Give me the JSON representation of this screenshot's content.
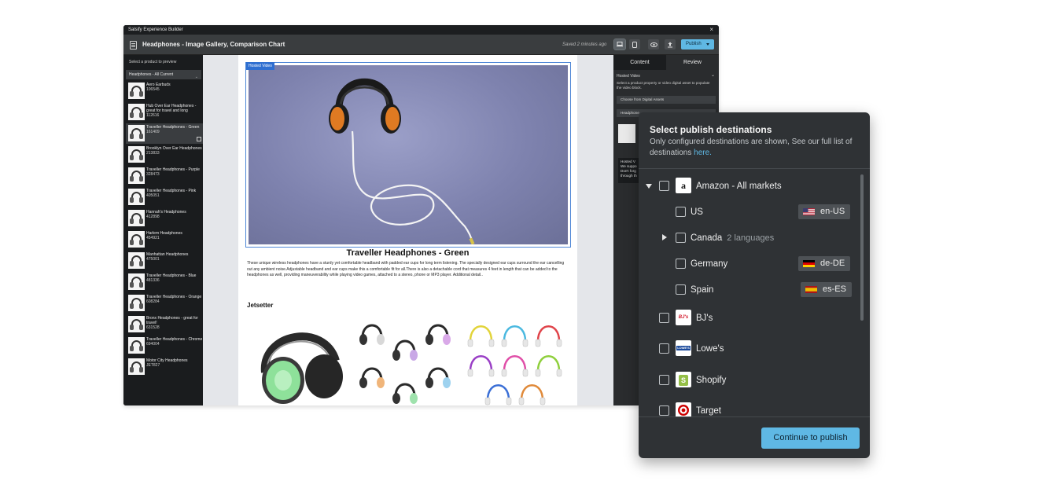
{
  "window": {
    "title": "Salsify Experience Builder",
    "close_label": "×"
  },
  "toolbar": {
    "title": "Headphones - Image Gallery, Comparison Chart",
    "saved": "Saved 2 minutes ago",
    "publish_label": "Publish"
  },
  "sidebar": {
    "hint": "Select a product to preview",
    "select_value": "Headphones - All Current",
    "products": [
      {
        "name": "Aero Earbuds",
        "sku": "106545"
      },
      {
        "name": "Hub Over Ear Headphones - great for travel and long",
        "sku": "112616"
      },
      {
        "name": "Traveller Headphones - Green",
        "sku": "161409",
        "selected": true
      },
      {
        "name": "Brooklyn Over Ear Headphones",
        "sku": "213833"
      },
      {
        "name": "Traveller Headphones - Purple",
        "sku": "328473"
      },
      {
        "name": "Traveller Headphones - Pink",
        "sku": "405051"
      },
      {
        "name": "Hannah's Headphones",
        "sku": "412898"
      },
      {
        "name": "Harlem Headphones",
        "sku": "454921"
      },
      {
        "name": "Manhattan Headphones",
        "sku": "475001"
      },
      {
        "name": "Traveller Headphones - Blue",
        "sku": "481336"
      },
      {
        "name": "Traveller Headphones - Orange",
        "sku": "608284"
      },
      {
        "name": "Bronx Headphones - great for travel!",
        "sku": "631528"
      },
      {
        "name": "Traveller Headphones - Chrome",
        "sku": "694004"
      },
      {
        "name": "Motor City Headphones",
        "sku": "JET827"
      }
    ]
  },
  "canvas": {
    "video_label": "Hosted Video",
    "product_title": "Traveller Headphones - Green",
    "description": "These unique wireless headphones have a sturdy yet comfortable headband with padded ear cups for long term listening. The specially designed ear cups surround the ear cancelling out any ambient noise.Adjustable headband and ear cups make this a comfortable fit for all.There is also a detachable cord that measures 4 feet in length that can be added to the headphones as well, providing maneuverability while playing video games, attached to a stereo, phone or MP3 player. Additional detail..",
    "section_title": "Jetsetter"
  },
  "right_panel": {
    "tabs": [
      "Content",
      "Review"
    ],
    "section": "Hosted Video",
    "help": "Select a product property or video digital asset to populate the video block.",
    "source_select": "Choose from Digital Assets",
    "property_select": "Headphone",
    "note": "Hosted V We suppo Don't forg through th"
  },
  "modal": {
    "title": "Select publish destinations",
    "subtitle_prefix": "Only configured destinations are shown, See our full list of destinations ",
    "subtitle_link": "here.",
    "destinations": {
      "amazon": {
        "label": "Amazon - All markets",
        "logo": "a"
      },
      "us": {
        "label": "US",
        "locale": "en-US"
      },
      "canada": {
        "label": "Canada",
        "meta": "2 languages"
      },
      "germany": {
        "label": "Germany",
        "locale": "de-DE"
      },
      "spain": {
        "label": "Spain",
        "locale": "es-ES"
      },
      "bjs": {
        "label": "BJ's",
        "logo": "BJ's"
      },
      "lowes": {
        "label": "Lowe's",
        "logo": "LOWE'S"
      },
      "shopify": {
        "label": "Shopify",
        "logo": "S"
      },
      "target": {
        "label": "Target"
      }
    },
    "continue_label": "Continue to publish"
  },
  "colors": {
    "accent": "#5fb8e4",
    "selection": "#2f6fd1",
    "panel": "#2f3235"
  }
}
